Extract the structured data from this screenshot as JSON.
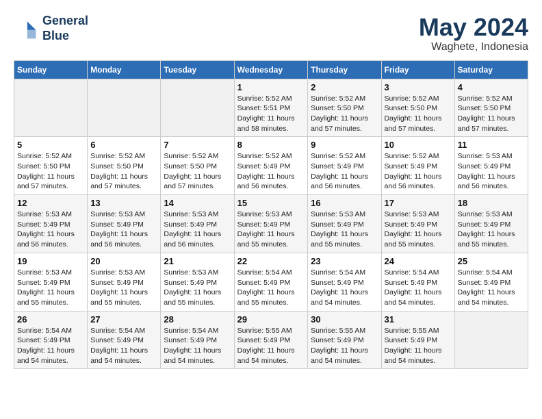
{
  "header": {
    "logo_line1": "General",
    "logo_line2": "Blue",
    "month": "May 2024",
    "location": "Waghete, Indonesia"
  },
  "weekdays": [
    "Sunday",
    "Monday",
    "Tuesday",
    "Wednesday",
    "Thursday",
    "Friday",
    "Saturday"
  ],
  "weeks": [
    [
      {
        "day": "",
        "sunrise": "",
        "sunset": "",
        "daylight": "",
        "empty": true
      },
      {
        "day": "",
        "sunrise": "",
        "sunset": "",
        "daylight": "",
        "empty": true
      },
      {
        "day": "",
        "sunrise": "",
        "sunset": "",
        "daylight": "",
        "empty": true
      },
      {
        "day": "1",
        "sunrise": "Sunrise: 5:52 AM",
        "sunset": "Sunset: 5:51 PM",
        "daylight": "Daylight: 11 hours and 58 minutes."
      },
      {
        "day": "2",
        "sunrise": "Sunrise: 5:52 AM",
        "sunset": "Sunset: 5:50 PM",
        "daylight": "Daylight: 11 hours and 57 minutes."
      },
      {
        "day": "3",
        "sunrise": "Sunrise: 5:52 AM",
        "sunset": "Sunset: 5:50 PM",
        "daylight": "Daylight: 11 hours and 57 minutes."
      },
      {
        "day": "4",
        "sunrise": "Sunrise: 5:52 AM",
        "sunset": "Sunset: 5:50 PM",
        "daylight": "Daylight: 11 hours and 57 minutes."
      }
    ],
    [
      {
        "day": "5",
        "sunrise": "Sunrise: 5:52 AM",
        "sunset": "Sunset: 5:50 PM",
        "daylight": "Daylight: 11 hours and 57 minutes."
      },
      {
        "day": "6",
        "sunrise": "Sunrise: 5:52 AM",
        "sunset": "Sunset: 5:50 PM",
        "daylight": "Daylight: 11 hours and 57 minutes."
      },
      {
        "day": "7",
        "sunrise": "Sunrise: 5:52 AM",
        "sunset": "Sunset: 5:50 PM",
        "daylight": "Daylight: 11 hours and 57 minutes."
      },
      {
        "day": "8",
        "sunrise": "Sunrise: 5:52 AM",
        "sunset": "Sunset: 5:49 PM",
        "daylight": "Daylight: 11 hours and 56 minutes."
      },
      {
        "day": "9",
        "sunrise": "Sunrise: 5:52 AM",
        "sunset": "Sunset: 5:49 PM",
        "daylight": "Daylight: 11 hours and 56 minutes."
      },
      {
        "day": "10",
        "sunrise": "Sunrise: 5:52 AM",
        "sunset": "Sunset: 5:49 PM",
        "daylight": "Daylight: 11 hours and 56 minutes."
      },
      {
        "day": "11",
        "sunrise": "Sunrise: 5:53 AM",
        "sunset": "Sunset: 5:49 PM",
        "daylight": "Daylight: 11 hours and 56 minutes."
      }
    ],
    [
      {
        "day": "12",
        "sunrise": "Sunrise: 5:53 AM",
        "sunset": "Sunset: 5:49 PM",
        "daylight": "Daylight: 11 hours and 56 minutes."
      },
      {
        "day": "13",
        "sunrise": "Sunrise: 5:53 AM",
        "sunset": "Sunset: 5:49 PM",
        "daylight": "Daylight: 11 hours and 56 minutes."
      },
      {
        "day": "14",
        "sunrise": "Sunrise: 5:53 AM",
        "sunset": "Sunset: 5:49 PM",
        "daylight": "Daylight: 11 hours and 56 minutes."
      },
      {
        "day": "15",
        "sunrise": "Sunrise: 5:53 AM",
        "sunset": "Sunset: 5:49 PM",
        "daylight": "Daylight: 11 hours and 55 minutes."
      },
      {
        "day": "16",
        "sunrise": "Sunrise: 5:53 AM",
        "sunset": "Sunset: 5:49 PM",
        "daylight": "Daylight: 11 hours and 55 minutes."
      },
      {
        "day": "17",
        "sunrise": "Sunrise: 5:53 AM",
        "sunset": "Sunset: 5:49 PM",
        "daylight": "Daylight: 11 hours and 55 minutes."
      },
      {
        "day": "18",
        "sunrise": "Sunrise: 5:53 AM",
        "sunset": "Sunset: 5:49 PM",
        "daylight": "Daylight: 11 hours and 55 minutes."
      }
    ],
    [
      {
        "day": "19",
        "sunrise": "Sunrise: 5:53 AM",
        "sunset": "Sunset: 5:49 PM",
        "daylight": "Daylight: 11 hours and 55 minutes."
      },
      {
        "day": "20",
        "sunrise": "Sunrise: 5:53 AM",
        "sunset": "Sunset: 5:49 PM",
        "daylight": "Daylight: 11 hours and 55 minutes."
      },
      {
        "day": "21",
        "sunrise": "Sunrise: 5:53 AM",
        "sunset": "Sunset: 5:49 PM",
        "daylight": "Daylight: 11 hours and 55 minutes."
      },
      {
        "day": "22",
        "sunrise": "Sunrise: 5:54 AM",
        "sunset": "Sunset: 5:49 PM",
        "daylight": "Daylight: 11 hours and 55 minutes."
      },
      {
        "day": "23",
        "sunrise": "Sunrise: 5:54 AM",
        "sunset": "Sunset: 5:49 PM",
        "daylight": "Daylight: 11 hours and 54 minutes."
      },
      {
        "day": "24",
        "sunrise": "Sunrise: 5:54 AM",
        "sunset": "Sunset: 5:49 PM",
        "daylight": "Daylight: 11 hours and 54 minutes."
      },
      {
        "day": "25",
        "sunrise": "Sunrise: 5:54 AM",
        "sunset": "Sunset: 5:49 PM",
        "daylight": "Daylight: 11 hours and 54 minutes."
      }
    ],
    [
      {
        "day": "26",
        "sunrise": "Sunrise: 5:54 AM",
        "sunset": "Sunset: 5:49 PM",
        "daylight": "Daylight: 11 hours and 54 minutes."
      },
      {
        "day": "27",
        "sunrise": "Sunrise: 5:54 AM",
        "sunset": "Sunset: 5:49 PM",
        "daylight": "Daylight: 11 hours and 54 minutes."
      },
      {
        "day": "28",
        "sunrise": "Sunrise: 5:54 AM",
        "sunset": "Sunset: 5:49 PM",
        "daylight": "Daylight: 11 hours and 54 minutes."
      },
      {
        "day": "29",
        "sunrise": "Sunrise: 5:55 AM",
        "sunset": "Sunset: 5:49 PM",
        "daylight": "Daylight: 11 hours and 54 minutes."
      },
      {
        "day": "30",
        "sunrise": "Sunrise: 5:55 AM",
        "sunset": "Sunset: 5:49 PM",
        "daylight": "Daylight: 11 hours and 54 minutes."
      },
      {
        "day": "31",
        "sunrise": "Sunrise: 5:55 AM",
        "sunset": "Sunset: 5:49 PM",
        "daylight": "Daylight: 11 hours and 54 minutes."
      },
      {
        "day": "",
        "sunrise": "",
        "sunset": "",
        "daylight": "",
        "empty": true
      }
    ]
  ]
}
